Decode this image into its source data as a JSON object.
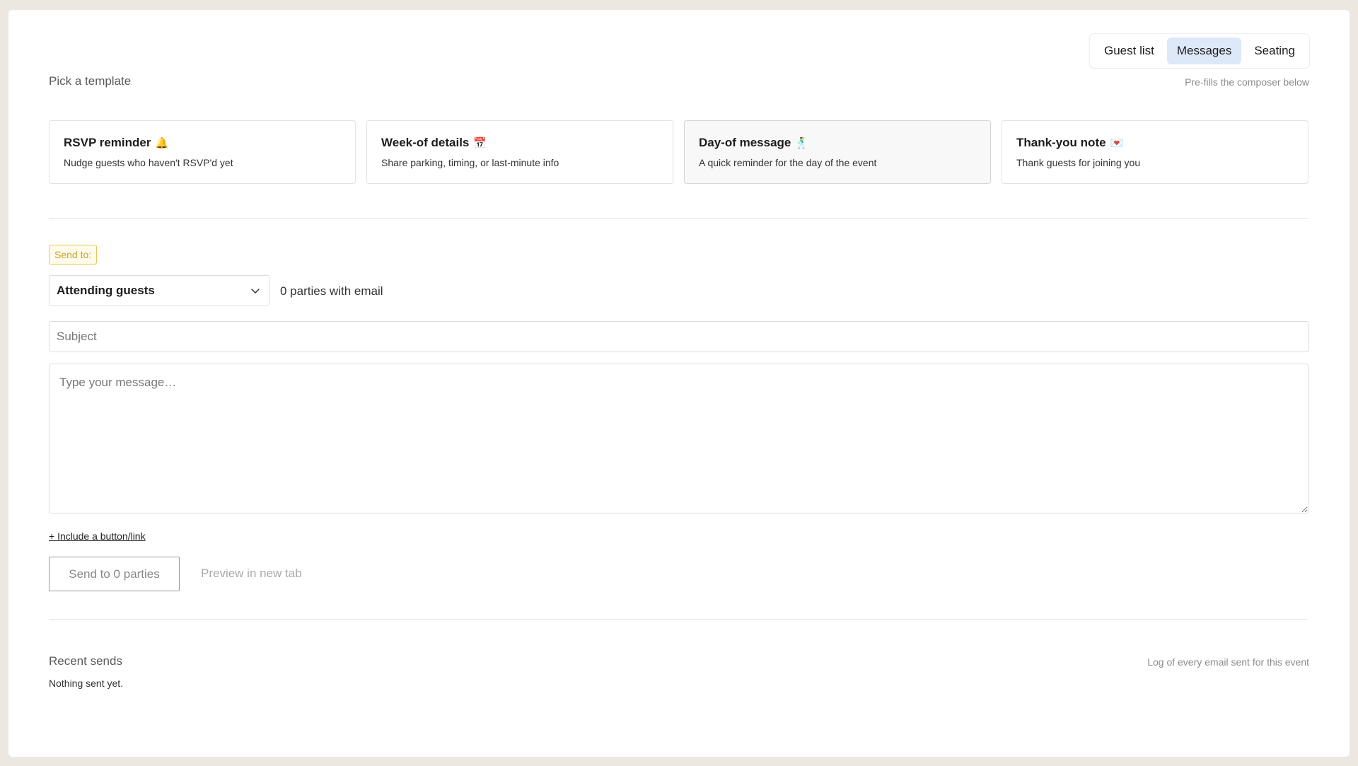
{
  "tabs": [
    {
      "label": "Guest list"
    },
    {
      "label": "Messages",
      "active": true
    },
    {
      "label": "Seating"
    }
  ],
  "templates_section": {
    "title": "Pick a template",
    "hint": "Pre-fills the composer below",
    "items": [
      {
        "title": "RSVP reminder",
        "emoji": "🔔",
        "description": "Nudge guests who haven't RSVP'd yet"
      },
      {
        "title": "Week-of details",
        "emoji": "📅",
        "description": "Share parking, timing, or last-minute info"
      },
      {
        "title": "Day-of message",
        "emoji": "🕺",
        "description": "A quick reminder for the day of the event",
        "selected": true
      },
      {
        "title": "Thank-you note",
        "emoji": "💌",
        "description": "Thank guests for joining you"
      }
    ]
  },
  "composer": {
    "send_to_label": "Send to:",
    "audience": "Attending guests",
    "parties_count": "0 parties with email",
    "subject_placeholder": "Subject",
    "message_placeholder": "Type your message…",
    "include_link": "+ Include a button/link",
    "send_button": "Send to 0 parties",
    "preview_button": "Preview in new tab"
  },
  "recent": {
    "title": "Recent sends",
    "hint": "Log of every email sent for this event",
    "empty": "Nothing sent yet."
  },
  "colors": {
    "active_tab": "#dde9f8",
    "badge_text": "#c9a227",
    "page_bg": "#ece7e0"
  }
}
